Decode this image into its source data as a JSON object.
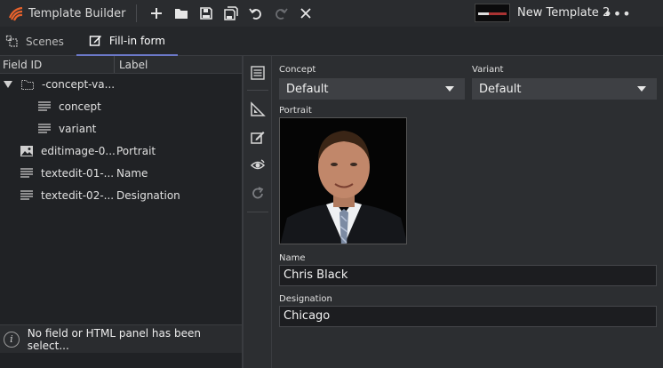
{
  "app": {
    "title": "Template Builder",
    "template_name": "New Template 2",
    "more": "•••"
  },
  "toolbar": {
    "icons": [
      "add-icon",
      "open-folder-icon",
      "save-icon",
      "save-as-icon",
      "undo-icon",
      "redo-icon",
      "close-icon"
    ]
  },
  "tabs": [
    {
      "label": "Scenes",
      "icon": "scenes-icon"
    },
    {
      "label": "Fill-in form",
      "icon": "edit-form-icon",
      "active": true
    }
  ],
  "tree": {
    "headers": {
      "field_id": "Field ID",
      "label": "Label"
    },
    "rows": [
      {
        "field_id": "-concept-va...",
        "label": "",
        "icon": "folder-icon",
        "expanded": true
      },
      {
        "field_id": "concept",
        "label": "",
        "icon": "text-lines-icon"
      },
      {
        "field_id": "variant",
        "label": "",
        "icon": "text-lines-icon"
      },
      {
        "field_id": "editimage-0...",
        "label": "Portrait",
        "icon": "image-icon"
      },
      {
        "field_id": "textedit-01-...",
        "label": "Name",
        "icon": "text-lines-icon"
      },
      {
        "field_id": "textedit-02-...",
        "label": "Designation",
        "icon": "text-lines-icon"
      }
    ]
  },
  "status": {
    "message": "No field or HTML panel has been select..."
  },
  "form": {
    "concept": {
      "label": "Concept",
      "value": "Default"
    },
    "variant": {
      "label": "Variant",
      "value": "Default"
    },
    "portrait": {
      "label": "Portrait"
    },
    "name": {
      "label": "Name",
      "value": "Chris Black"
    },
    "designation": {
      "label": "Designation",
      "value": "Chicago"
    }
  },
  "colors": {
    "accent": "#6b78c8",
    "background": "#2c2e31",
    "panel": "#202225",
    "logo": "#e8622c"
  }
}
